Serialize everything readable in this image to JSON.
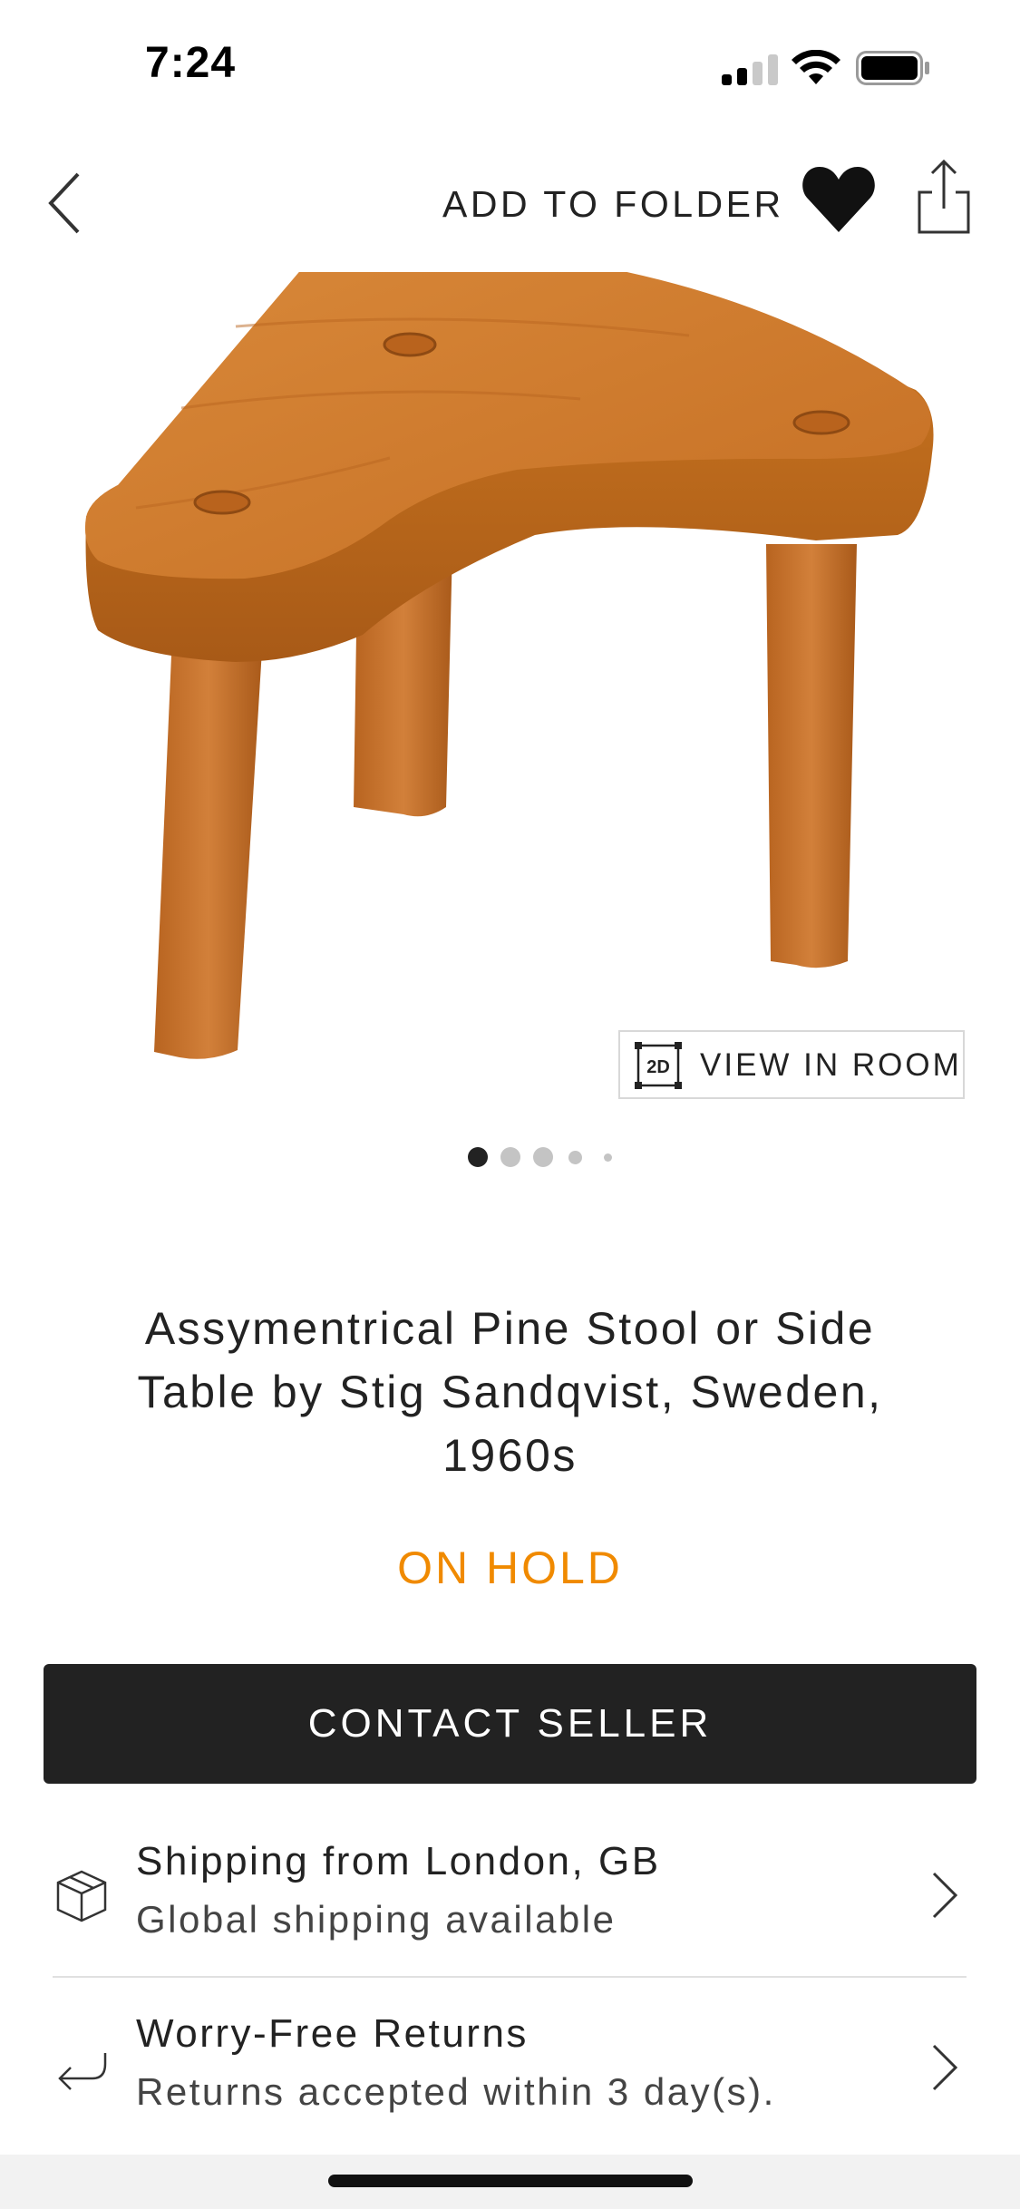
{
  "status_bar": {
    "time": "7:24",
    "icons": [
      "cellular-signal-icon",
      "wifi-icon",
      "battery-icon"
    ]
  },
  "nav": {
    "back_icon": "chevron-left-icon",
    "add_to_folder_label": "ADD TO FOLDER",
    "favorite_icon": "heart-filled-icon",
    "share_icon": "share-icon"
  },
  "gallery": {
    "view_in_room_label": "VIEW IN ROOM",
    "view_in_room_icon_text": "2D",
    "page_count": 5,
    "active_page": 1
  },
  "product": {
    "title": "Assymentrical Pine Stool or Side Table by Stig Sandqvist, Sweden, 1960s",
    "status": "ON HOLD",
    "status_color": "#f08a00"
  },
  "actions": {
    "contact_label": "CONTACT SELLER"
  },
  "info_rows": [
    {
      "icon": "package-box-icon",
      "title": "Shipping from London, GB",
      "subtitle": "Global shipping available"
    },
    {
      "icon": "return-arrow-icon",
      "title": "Worry-Free Returns",
      "subtitle": "Returns accepted within 3 day(s)."
    }
  ],
  "colors": {
    "button_bg": "#222222",
    "accent": "#f08a00",
    "wood": "#c8772c"
  }
}
